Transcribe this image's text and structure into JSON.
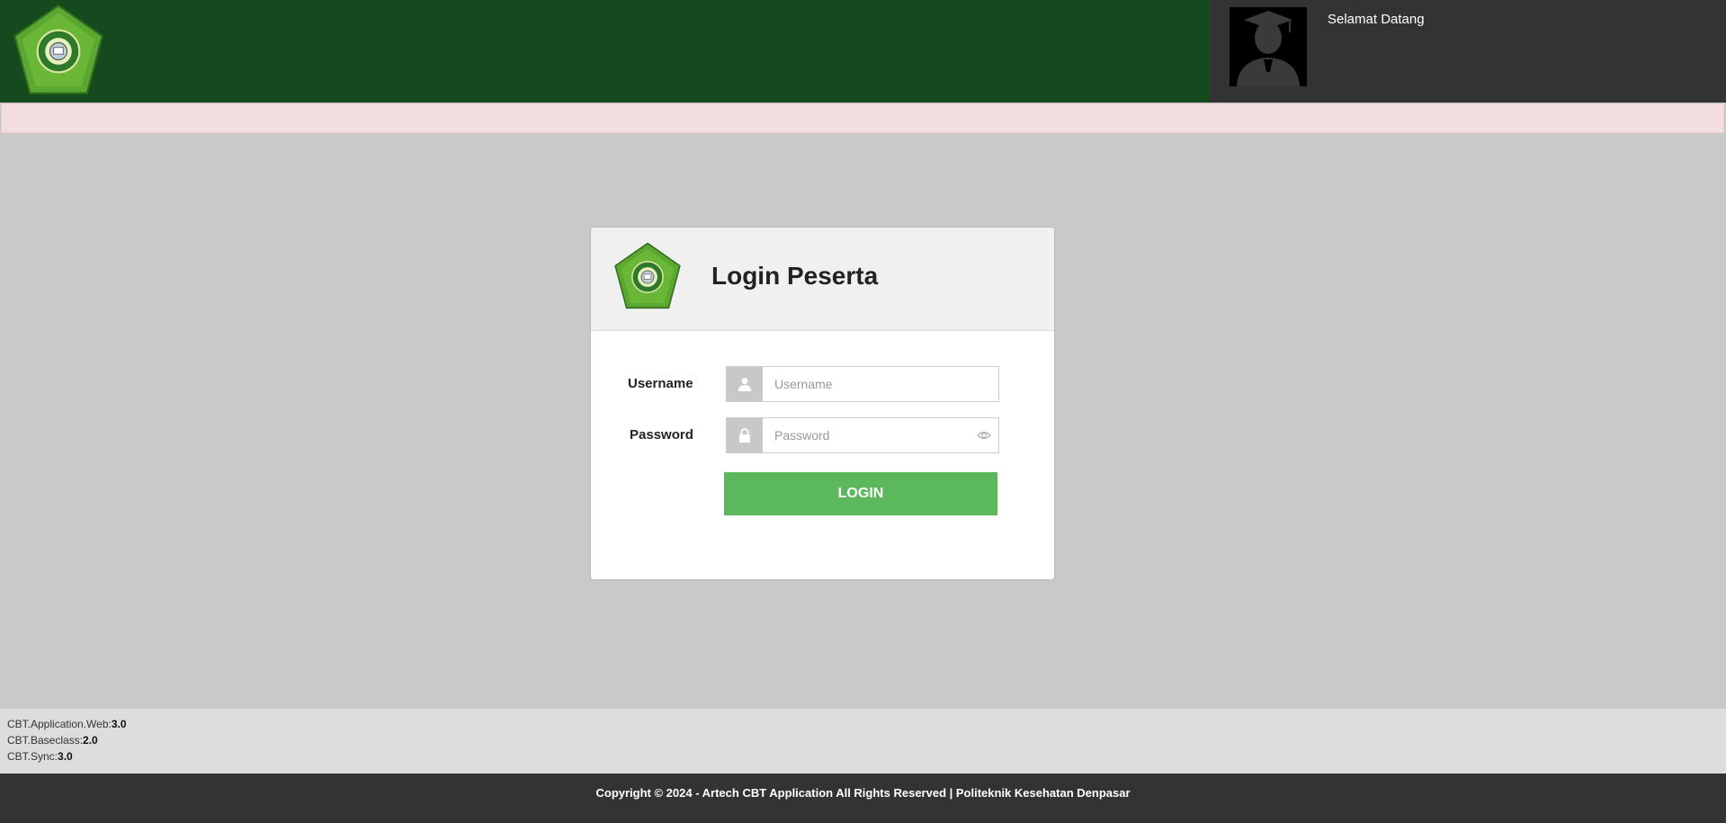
{
  "header": {
    "welcome_text": "Selamat Datang"
  },
  "login": {
    "title": "Login Peserta",
    "username_label": "Username",
    "username_placeholder": "Username",
    "password_label": "Password",
    "password_placeholder": "Password",
    "login_button": "LOGIN"
  },
  "versions": [
    {
      "name": "CBT.Application.Web:",
      "value": "3.0"
    },
    {
      "name": "CBT.Baseclass:",
      "value": "2.0"
    },
    {
      "name": "CBT.Sync:",
      "value": "3.0"
    }
  ],
  "footer": {
    "copyright": "Copyright © 2024 - Artech CBT Application All Rights Reserved | Politeknik Kesehatan Denpasar"
  },
  "colors": {
    "header_green": "#154a1e",
    "header_dark": "#333333",
    "alert_bg": "#f2dede",
    "page_bg": "#c9c9c9",
    "button_green": "#5cb85c",
    "logo_green": "#6ab637"
  },
  "icons": [
    "institution-logo",
    "user-avatar-icon",
    "user-icon",
    "lock-icon",
    "eye-icon"
  ]
}
